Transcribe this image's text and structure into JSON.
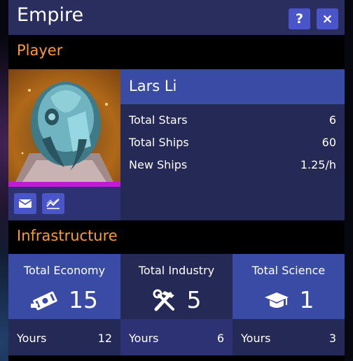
{
  "window": {
    "title": "Empire",
    "help_label": "?",
    "close_label": "×"
  },
  "player": {
    "section_title": "Player",
    "name": "Lars Li",
    "stats": [
      {
        "label": "Total Stars",
        "value": "6"
      },
      {
        "label": "Total Ships",
        "value": "60"
      },
      {
        "label": "New Ships",
        "value": "1.25/h"
      }
    ],
    "tools": {
      "mail_icon": "envelope-icon",
      "chart_icon": "line-chart-icon"
    }
  },
  "infrastructure": {
    "section_title": "Infrastructure",
    "cards": [
      {
        "title": "Total Economy",
        "value": "15",
        "icon": "money-icon",
        "yours_label": "Yours",
        "yours_value": "12"
      },
      {
        "title": "Total Industry",
        "value": "5",
        "icon": "tools-icon",
        "yours_label": "Yours",
        "yours_value": "6"
      },
      {
        "title": "Total Science",
        "value": "1",
        "icon": "graduation-cap-icon",
        "yours_label": "Yours",
        "yours_value": "3"
      }
    ]
  },
  "colors": {
    "section_heading": "#ff9b2e",
    "button": "#4a55c9",
    "accent_stripe": "#c21ad0",
    "title_bar": "#2a2e5e"
  }
}
